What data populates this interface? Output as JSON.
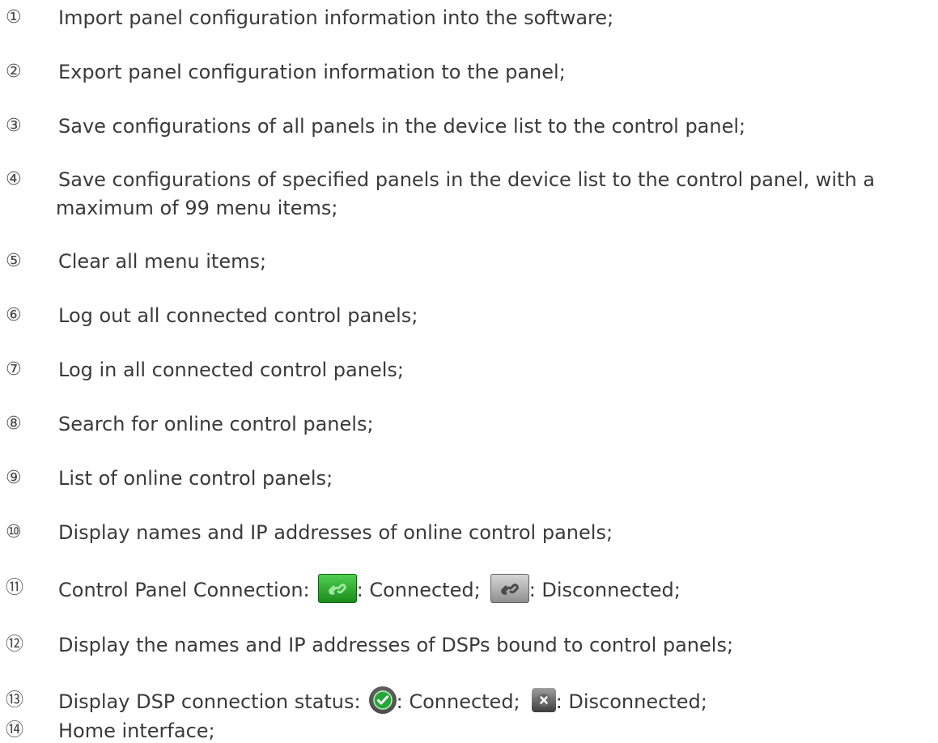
{
  "items": [
    {
      "num": "①",
      "text": "Import panel configuration information into the software;"
    },
    {
      "num": "②",
      "text": "Export panel configuration information to the panel;"
    },
    {
      "num": "③",
      "text": "Save configurations of all panels in the device list to the control panel;"
    },
    {
      "num": "④",
      "text": "Save configurations of specified panels in the device list to the control panel, with a",
      "text_line2": "maximum of 99 menu items;"
    },
    {
      "num": "⑤",
      "text": "Clear all menu items;"
    },
    {
      "num": "⑥",
      "text": "Log out all connected control panels;"
    },
    {
      "num": "⑦",
      "text": "Log in all connected control panels;"
    },
    {
      "num": "⑧",
      "text": "Search for online control panels;"
    },
    {
      "num": "⑨",
      "text": "List of online control panels;"
    },
    {
      "num": "⑩",
      "text": "Display names and IP addresses of online control panels;"
    },
    {
      "num": "⑪",
      "text": "Control Panel Connection:",
      "after_icon1": ": Connected;",
      "after_icon2": ": Disconnected;"
    },
    {
      "num": "⑫",
      "text": "Display the names and IP addresses of DSPs bound to control panels;"
    },
    {
      "num": "⑬",
      "text": "Display DSP connection status:",
      "after_icon1": ": Connected;",
      "after_icon2": ": Disconnected;"
    },
    {
      "num": "⑭",
      "text": "Home interface;"
    }
  ],
  "icons": {
    "panel_connected": "link-icon-green",
    "panel_disconnected": "link-icon-grey",
    "dsp_connected": "check-circle-icon",
    "dsp_disconnected": "close-square-icon"
  },
  "colors": {
    "text": "#3a3a3a",
    "connected_green": "#2aa52a",
    "disconnected_grey": "#9a9a9a"
  }
}
